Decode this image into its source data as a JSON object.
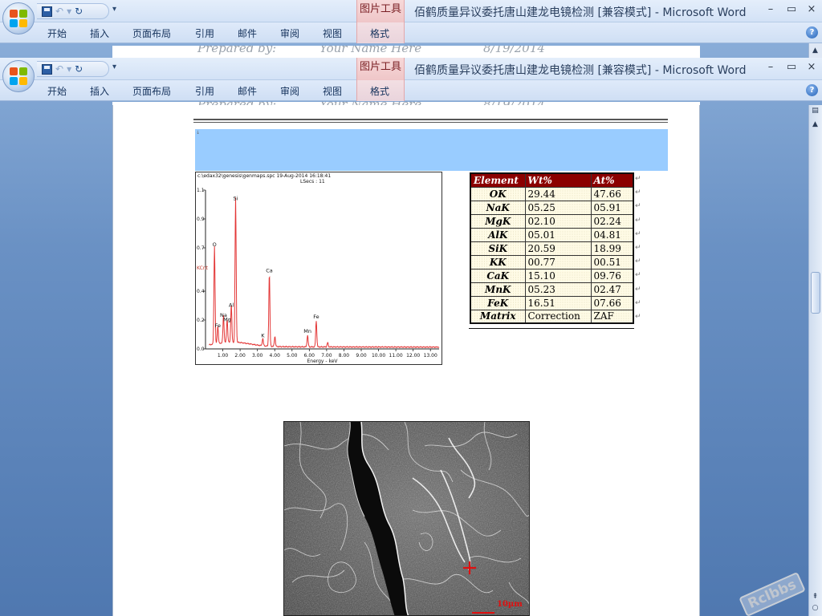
{
  "app": {
    "title": "佰鹤质量异议委托唐山建龙电镜检测 [兼容模式] - Microsoft Word",
    "context_tab": "图片工具",
    "tabs": [
      "开始",
      "插入",
      "页面布局",
      "引用",
      "邮件",
      "审阅",
      "视图",
      "格式"
    ],
    "help": "?",
    "window_controls": {
      "minimize": "–",
      "restore": "▭",
      "close": "×"
    }
  },
  "header_strip": {
    "prepared_by": "Prepared by:",
    "name": "Your Name Here",
    "date": "8/19/2014"
  },
  "page_marker": "↓",
  "spectrum": {
    "path": "c:\\edax32\\genesis\\genmaps.spc",
    "timestamp": "19-Aug-2014 16:18:41",
    "lsecs": "LSecs :   11",
    "ylabel": "KCnt",
    "xlabel": "Energy - keV"
  },
  "chart_data": {
    "type": "line",
    "xlabel": "Energy - keV",
    "ylabel": "KCnt",
    "xlim": [
      0,
      13.5
    ],
    "ylim": [
      0,
      1.1
    ],
    "xticks": [
      1,
      2,
      3,
      4,
      5,
      6,
      7,
      8,
      9,
      10,
      11,
      12,
      13
    ],
    "xtick_labels": [
      "1.00",
      "2.00",
      "3.00",
      "4.00",
      "5.00",
      "6.00",
      "7.00",
      "8.00",
      "9.00",
      "10.00",
      "11.00",
      "12.00",
      "13.00"
    ],
    "yticks": [
      0,
      0.2,
      0.4,
      0.7,
      0.9,
      1.1
    ],
    "ytick_labels": [
      "0.0",
      "0.2",
      "0.4",
      "0.7",
      "0.9",
      "1.1"
    ],
    "peaks": [
      {
        "label": "O",
        "energy": 0.52,
        "height": 0.68
      },
      {
        "label": "Fe",
        "energy": 0.71,
        "height": 0.12
      },
      {
        "label": "Na",
        "energy": 1.04,
        "height": 0.19
      },
      {
        "label": "Mg",
        "energy": 1.25,
        "height": 0.16
      },
      {
        "label": "Al",
        "energy": 1.49,
        "height": 0.26
      },
      {
        "label": "Si",
        "energy": 1.74,
        "height": 1.0
      },
      {
        "label": "K",
        "energy": 3.31,
        "height": 0.05
      },
      {
        "label": "Ca",
        "energy": 3.69,
        "height": 0.5
      },
      {
        "label": "Ca",
        "energy": 4.01,
        "height": 0.07,
        "hidden_label": true
      },
      {
        "label": "Mn",
        "energy": 5.9,
        "height": 0.08
      },
      {
        "label": "Fe",
        "energy": 6.4,
        "height": 0.18
      },
      {
        "label": "Fe",
        "energy": 7.06,
        "height": 0.03,
        "hidden_label": true
      }
    ],
    "line_color": "#e02020"
  },
  "eds_table": {
    "headers": [
      "Element",
      "Wt%",
      "At%"
    ],
    "rows": [
      [
        "OK",
        "29.44",
        "47.66"
      ],
      [
        "NaK",
        "05.25",
        "05.91"
      ],
      [
        "MgK",
        "02.10",
        "02.24"
      ],
      [
        "AlK",
        "05.01",
        "04.81"
      ],
      [
        "SiK",
        "20.59",
        "18.99"
      ],
      [
        "KK",
        "00.77",
        "00.51"
      ],
      [
        "CaK",
        "15.10",
        "09.76"
      ],
      [
        "MnK",
        "05.23",
        "02.47"
      ],
      [
        "FeK",
        "16.51",
        "07.66"
      ],
      [
        "Matrix",
        "Correction",
        "ZAF"
      ]
    ],
    "cell_mark": "↵",
    "header_color": "#8b0000"
  },
  "sem": {
    "scale_label": "10µm",
    "marker": "+",
    "accent": "#e01010"
  },
  "watermark": "Rclbbs"
}
